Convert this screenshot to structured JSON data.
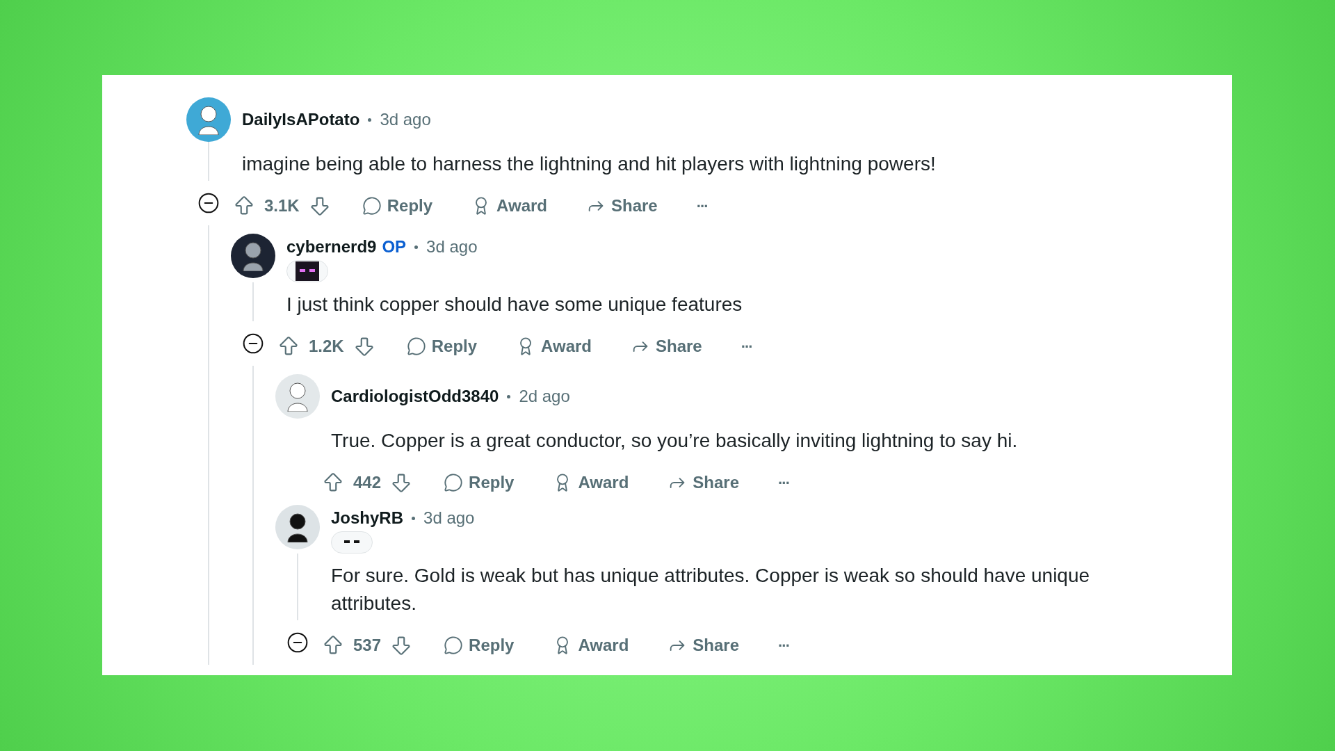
{
  "comments": [
    {
      "username": "DailyIsAPotato",
      "time": "3d ago",
      "has_flair": false,
      "body": "imagine being able to harness the lightning and hit players with lightning powers!",
      "votes": "3.1K",
      "collapsible": true,
      "actions": [
        {
          "kind": "reply",
          "label": "Reply"
        },
        {
          "kind": "award",
          "label": "Award"
        },
        {
          "kind": "share",
          "label": "Share"
        },
        {
          "kind": "more",
          "label": "···"
        }
      ],
      "children": [
        {
          "username": "cybernerd9",
          "op_label": "OP",
          "time": "3d ago",
          "has_flair": true,
          "body": "I just think copper should have some unique features",
          "votes": "1.2K",
          "collapsible": true,
          "actions": [
            {
              "kind": "reply",
              "label": "Reply"
            },
            {
              "kind": "award",
              "label": "Award"
            },
            {
              "kind": "share",
              "label": "Share"
            },
            {
              "kind": "more",
              "label": "···"
            }
          ],
          "children": [
            {
              "username": "CardiologistOdd3840",
              "time": "2d ago",
              "has_flair": false,
              "body": "True. Copper is a great conductor, so you’re basically inviting lightning to say hi.",
              "votes": "442",
              "collapsible": false,
              "actions": [
                {
                  "kind": "reply",
                  "label": "Reply"
                },
                {
                  "kind": "award",
                  "label": "Award"
                },
                {
                  "kind": "share",
                  "label": "Share"
                },
                {
                  "kind": "more",
                  "label": "···"
                }
              ]
            },
            {
              "username": "JoshyRB",
              "time": "3d ago",
              "has_flair": true,
              "body": "For sure. Gold is weak but has unique attributes. Copper is weak so should have unique attributes.",
              "votes": "537",
              "collapsible": true,
              "actions": [
                {
                  "kind": "reply",
                  "label": "Reply"
                },
                {
                  "kind": "award",
                  "label": "Award"
                },
                {
                  "kind": "share",
                  "label": "Share"
                },
                {
                  "kind": "more",
                  "label": "···"
                }
              ]
            }
          ]
        }
      ]
    }
  ]
}
